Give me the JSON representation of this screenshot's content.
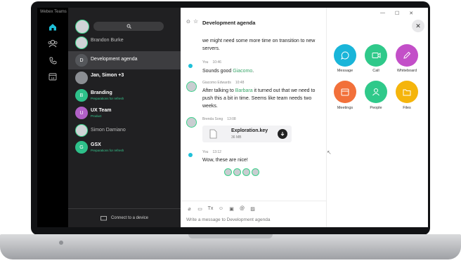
{
  "app_title": "Webex Teams",
  "rail": {
    "items": [
      {
        "name": "messaging",
        "icon": "home-icon"
      },
      {
        "name": "teams",
        "icon": "people-icon"
      },
      {
        "name": "calls",
        "icon": "phone-icon"
      },
      {
        "name": "meetings",
        "icon": "calendar-icon",
        "badge": "18"
      }
    ]
  },
  "list": {
    "search_placeholder": "",
    "connect_label": "Connect to a device",
    "rows": [
      {
        "name": "Brandon Burke",
        "sub": "",
        "initial": ""
      },
      {
        "name": "Development agenda",
        "sub": "",
        "initial": "D"
      },
      {
        "name": "Jan, Simon +3",
        "sub": "",
        "initial": ""
      },
      {
        "name": "Branding",
        "sub": "Preparations for refresh",
        "initial": "B"
      },
      {
        "name": "UX Team",
        "sub": "Product",
        "initial": "U"
      },
      {
        "name": "Simon Damiano",
        "sub": "",
        "initial": ""
      },
      {
        "name": "GSX",
        "sub": "Preparations for refresh",
        "initial": "G"
      }
    ]
  },
  "chat": {
    "title": "Development agenda",
    "messages": [
      {
        "text": "we might need some more time on transition to new servers."
      },
      {
        "author": "You",
        "time": "10:46",
        "text_pre": "Sounds good ",
        "mention": "Giacomo",
        "text_post": "."
      },
      {
        "author": "Giacomo Edwards",
        "time": "10:48",
        "text_pre": "After talking to ",
        "mention": "Barbara",
        "text_post": " it turned out that we need to push this a bit in time. Seems like team needs two weeks."
      },
      {
        "author": "Brenda Song",
        "time": "13:08",
        "file_name": "Exploration.key",
        "file_size": "36 MB"
      },
      {
        "author": "You",
        "time": "13:12",
        "text": "Wow, these are nice!"
      }
    ],
    "composer_placeholder": "Write a message to Development agenda"
  },
  "activity": {
    "tiles": [
      {
        "label": "Message",
        "color": "#19b5d9"
      },
      {
        "label": "Call",
        "color": "#2fc98a"
      },
      {
        "label": "Whiteboard",
        "color": "#c34fc8"
      },
      {
        "label": "Meetings",
        "color": "#f2703a"
      },
      {
        "label": "People",
        "color": "#2fc98a"
      },
      {
        "label": "Files",
        "color": "#f5b50c"
      }
    ]
  }
}
